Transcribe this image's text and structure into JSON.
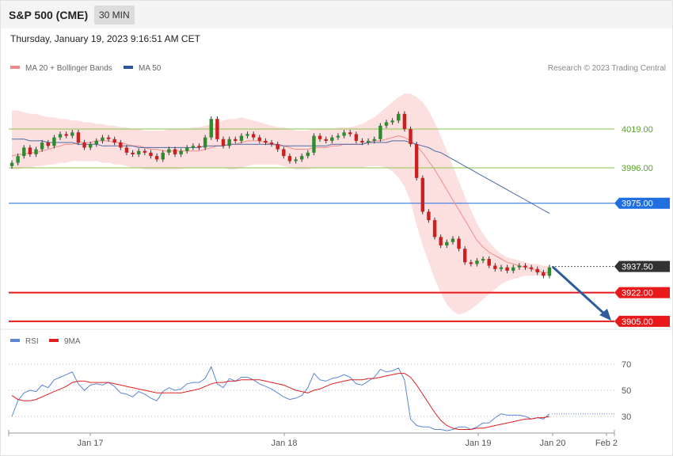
{
  "header": {
    "symbol": "S&P 500 (CME)",
    "timeframe": "30 MIN"
  },
  "timestamp": "Thursday, January 19, 2023 9:16:51 AM CET",
  "legend": {
    "main": [
      {
        "label": "MA 20 + Bollinger Bands",
        "color": "#f08a8a"
      },
      {
        "label": "MA 50",
        "color": "#2b5797"
      }
    ],
    "rsi": [
      {
        "label": "RSI",
        "color": "#5b86d6"
      },
      {
        "label": "9MA",
        "color": "#e02020"
      }
    ]
  },
  "copyright": "Research © 2023 Trading Central",
  "colors": {
    "up": "#2e8b2e",
    "down": "#cc1f1f",
    "support": "#e8191a",
    "pivot": "#1f6fe0",
    "resistance": "#8bc34a",
    "arrow": "#2c5c9a"
  },
  "chart_data": [
    {
      "type": "candlestick",
      "ylim": [
        3895,
        4060
      ],
      "x_ticks": [
        "Jan 17",
        "Jan 18",
        "Jan 19",
        "Jan 20",
        "Feb 2"
      ],
      "levels": [
        {
          "value": 4019.0,
          "label": "4019.00",
          "kind": "resistance"
        },
        {
          "value": 3996.0,
          "label": "3996.00",
          "kind": "resistance"
        },
        {
          "value": 3975.0,
          "label": "3975.00",
          "kind": "pivot"
        },
        {
          "value": 3937.5,
          "label": "3937.50",
          "kind": "last"
        },
        {
          "value": 3922.0,
          "label": "3922.00",
          "kind": "support"
        },
        {
          "value": 3905.0,
          "label": "3905.00",
          "kind": "support"
        }
      ],
      "close": [
        3999,
        4003,
        4008,
        4004,
        4007,
        4011,
        4009,
        4014,
        4016,
        4015,
        4017,
        4011,
        4008,
        4010,
        4012,
        4014,
        4013,
        4011,
        4008,
        4005,
        4004,
        4006,
        4005,
        4003,
        4001,
        4005,
        4007,
        4004,
        4006,
        4008,
        4009,
        4008,
        4014,
        4025,
        4013,
        4009,
        4013,
        4012,
        4015,
        4016,
        4014,
        4012,
        4011,
        4010,
        4007,
        4003,
        4000,
        4001,
        4003,
        4005,
        4015,
        4013,
        4012,
        4014,
        4015,
        4017,
        4016,
        4012,
        4011,
        4012,
        4013,
        4021,
        4023,
        4024,
        4028,
        4019,
        4010,
        3990,
        3970,
        3965,
        3955,
        3950,
        3952,
        3954,
        3948,
        3940,
        3939,
        3941,
        3942,
        3938,
        3936,
        3937,
        3935,
        3937,
        3938,
        3937,
        3936,
        3934,
        3932,
        3937
      ],
      "ma20": [
        4003,
        4004,
        4004,
        4005,
        4005,
        4006,
        4007,
        4008,
        4009,
        4010,
        4010,
        4011,
        4011,
        4011,
        4012,
        4012,
        4012,
        4011,
        4011,
        4010,
        4009,
        4009,
        4008,
        4007,
        4007,
        4006,
        4006,
        4006,
        4006,
        4006,
        4006,
        4006,
        4007,
        4008,
        4009,
        4009,
        4010,
        4010,
        4011,
        4012,
        4012,
        4012,
        4011,
        4010,
        4009,
        4009,
        4008,
        4007,
        4007,
        4007,
        4008,
        4008,
        4008,
        4009,
        4009,
        4010,
        4010,
        4010,
        4010,
        4011,
        4012,
        4012,
        4013,
        4014,
        4015,
        4014,
        4012,
        4009,
        4005,
        4000,
        3995,
        3989,
        3983,
        3977,
        3971,
        3965,
        3959,
        3953,
        3949,
        3946,
        3944,
        3942,
        3940,
        3939,
        3938,
        3937,
        3936,
        3935,
        3934,
        3934
      ],
      "ma50": [
        4013,
        4013,
        4013,
        4012,
        4012,
        4012,
        4011,
        4011,
        4011,
        4011,
        4011,
        4010,
        4010,
        4010,
        4010,
        4009,
        4009,
        4009,
        4009,
        4009,
        4009,
        4008,
        4008,
        4008,
        4008,
        4008,
        4008,
        4008,
        4008,
        4008,
        4008,
        4008,
        4009,
        4009,
        4009,
        4009,
        4010,
        4010,
        4010,
        4010,
        4010,
        4010,
        4010,
        4010,
        4010,
        4009,
        4009,
        4009,
        4009,
        4009,
        4009,
        4009,
        4009,
        4010,
        4010,
        4010,
        4010,
        4010,
        4010,
        4011,
        4011,
        4011,
        4011,
        4012,
        4012,
        4012,
        4011,
        4010,
        4009,
        4008,
        4006,
        4005,
        4003,
        4001,
        3999,
        3997,
        3995,
        3993,
        3991,
        3989,
        3987,
        3985,
        3983,
        3981,
        3979,
        3977,
        3975,
        3973,
        3971,
        3969
      ],
      "bb_upper": [
        4030,
        4030,
        4029,
        4028,
        4028,
        4027,
        4026,
        4026,
        4025,
        4025,
        4024,
        4024,
        4023,
        4023,
        4022,
        4022,
        4021,
        4021,
        4020,
        4020,
        4019,
        4019,
        4018,
        4018,
        4018,
        4018,
        4019,
        4019,
        4019,
        4019,
        4020,
        4020,
        4021,
        4022,
        4023,
        4024,
        4025,
        4025,
        4026,
        4025,
        4024,
        4023,
        4022,
        4021,
        4020,
        4020,
        4019,
        4018,
        4018,
        4018,
        4019,
        4019,
        4019,
        4019,
        4020,
        4020,
        4020,
        4021,
        4022,
        4024,
        4026,
        4029,
        4032,
        4035,
        4038,
        4040,
        4040,
        4038,
        4035,
        4030,
        4023,
        4015,
        4006,
        3997,
        3988,
        3979,
        3971,
        3963,
        3957,
        3952,
        3948,
        3945,
        3943,
        3942,
        3941,
        3940,
        3939,
        3939,
        3938,
        3938
      ],
      "bb_lower": [
        3995,
        3995,
        3996,
        3996,
        3997,
        3997,
        3998,
        3998,
        3999,
        3999,
        4000,
        4000,
        4000,
        4000,
        4000,
        3999,
        3999,
        3998,
        3998,
        3997,
        3996,
        3996,
        3995,
        3995,
        3995,
        3995,
        3995,
        3995,
        3995,
        3996,
        3996,
        3996,
        3996,
        3996,
        3996,
        3996,
        3995,
        3995,
        3996,
        3997,
        3998,
        3998,
        3998,
        3998,
        3998,
        3997,
        3996,
        3995,
        3995,
        3995,
        3996,
        3996,
        3996,
        3996,
        3996,
        3996,
        3996,
        3996,
        3996,
        3997,
        3997,
        3997,
        3996,
        3994,
        3990,
        3985,
        3976,
        3962,
        3950,
        3940,
        3930,
        3922,
        3915,
        3911,
        3909,
        3910,
        3912,
        3915,
        3918,
        3921,
        3924,
        3927,
        3929,
        3930,
        3931,
        3932,
        3932,
        3932,
        3932,
        3932
      ]
    },
    {
      "type": "line",
      "title": "RSI",
      "ylim": [
        15,
        85
      ],
      "y_ticks": [
        70,
        50,
        30
      ],
      "series": [
        {
          "name": "RSI",
          "values": [
            30,
            42,
            48,
            50,
            49,
            54,
            52,
            58,
            60,
            62,
            64,
            55,
            50,
            54,
            55,
            54,
            56,
            53,
            48,
            47,
            45,
            49,
            47,
            44,
            42,
            49,
            52,
            50,
            51,
            55,
            56,
            56,
            59,
            68,
            55,
            52,
            59,
            57,
            60,
            60,
            58,
            55,
            53,
            51,
            48,
            45,
            43,
            44,
            46,
            52,
            63,
            58,
            57,
            59,
            60,
            62,
            60,
            55,
            54,
            57,
            60,
            66,
            64,
            65,
            67,
            58,
            28,
            23,
            22,
            22,
            20,
            20,
            19,
            20,
            22,
            22,
            20,
            22,
            25,
            25,
            29,
            32,
            31,
            31,
            31,
            30,
            28,
            29,
            28,
            32
          ]
        },
        {
          "name": "9MA",
          "values": [
            46,
            43,
            42,
            42,
            43,
            45,
            47,
            49,
            51,
            53,
            56,
            57,
            57,
            56,
            56,
            56,
            56,
            55,
            54,
            53,
            52,
            51,
            50,
            49,
            48,
            48,
            48,
            48,
            48,
            49,
            50,
            51,
            53,
            55,
            56,
            56,
            57,
            57,
            58,
            58,
            58,
            58,
            57,
            56,
            55,
            54,
            52,
            50,
            49,
            48,
            50,
            51,
            53,
            55,
            56,
            57,
            58,
            58,
            58,
            59,
            59,
            60,
            61,
            62,
            63,
            63,
            60,
            54,
            47,
            40,
            33,
            27,
            23,
            21,
            20,
            20,
            20,
            21,
            21,
            22,
            23,
            24,
            25,
            26,
            27,
            28,
            28,
            29,
            29,
            30
          ]
        }
      ]
    }
  ]
}
